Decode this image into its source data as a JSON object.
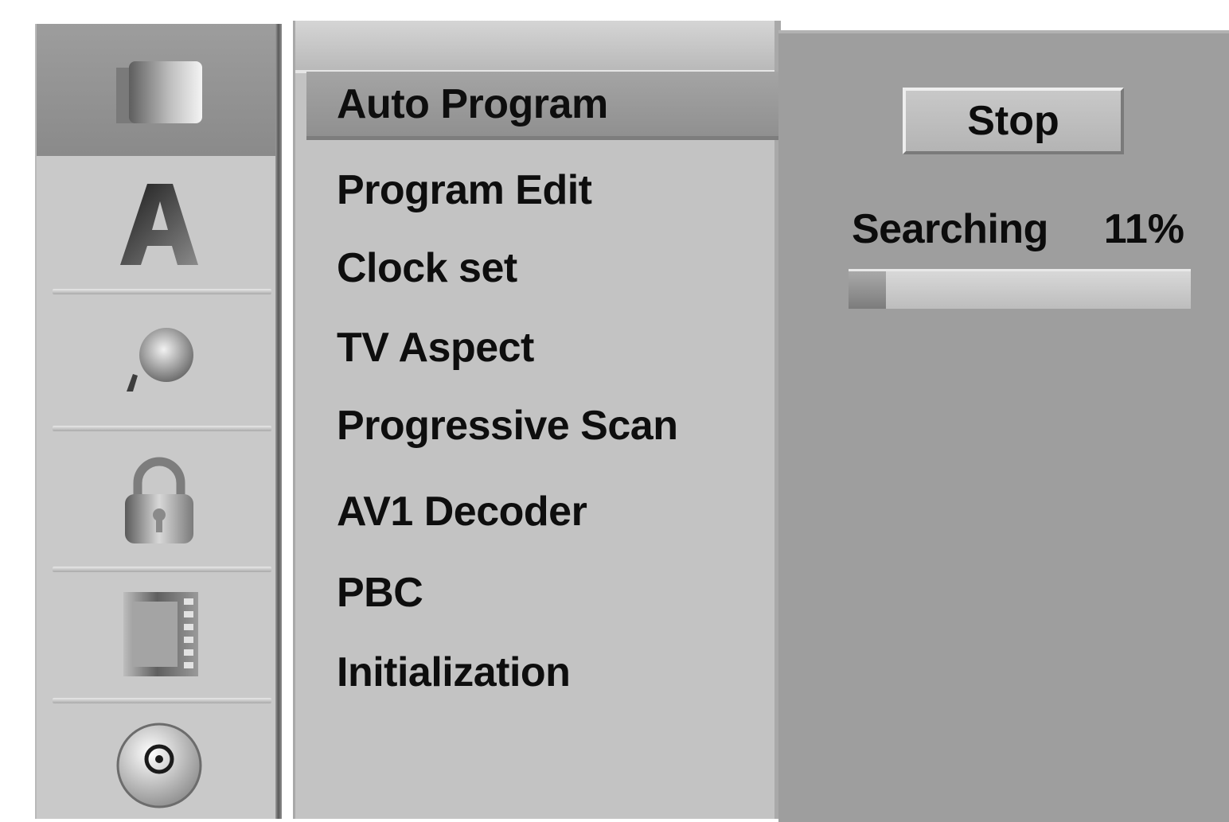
{
  "sidebar": {
    "icons": [
      {
        "name": "setup-folder-icon",
        "selected": true
      },
      {
        "name": "language-icon",
        "selected": false
      },
      {
        "name": "audio-icon",
        "selected": false
      },
      {
        "name": "lock-icon",
        "selected": false
      },
      {
        "name": "film-strip-icon",
        "selected": false
      },
      {
        "name": "disc-icon",
        "selected": false
      }
    ]
  },
  "menu": {
    "items": [
      {
        "label": "Auto Program",
        "selected": true
      },
      {
        "label": "Program Edit",
        "selected": false
      },
      {
        "label": "Clock set",
        "selected": false
      },
      {
        "label": "TV Aspect",
        "selected": false
      },
      {
        "label": "Progressive Scan",
        "selected": false
      },
      {
        "label": "AV1 Decoder",
        "selected": false
      },
      {
        "label": "PBC",
        "selected": false
      },
      {
        "label": "Initialization",
        "selected": false
      }
    ]
  },
  "content": {
    "stop_label": "Stop",
    "searching_label": "Searching",
    "searching_percent": "11%",
    "progress_fraction": 0.11
  },
  "colors": {
    "panel_light": "#c3c3c3",
    "panel_dark": "#9e9e9e",
    "selection": "#929292",
    "text": "#0e0e0e"
  }
}
